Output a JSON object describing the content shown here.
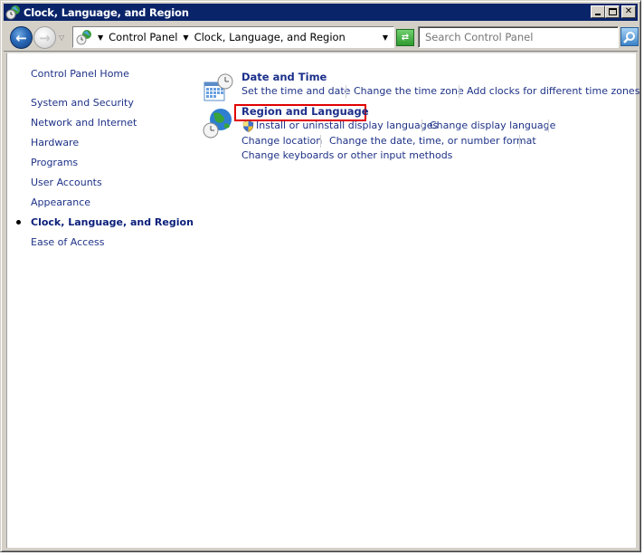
{
  "window": {
    "title": "Clock, Language, and Region",
    "controls": {
      "minimize": "_",
      "maximize": "□",
      "close": "✕"
    }
  },
  "toolbar": {
    "back_icon": "back-arrow-icon",
    "forward_icon": "forward-arrow-icon",
    "breadcrumb": [
      "Control Panel",
      "Clock, Language, and Region"
    ],
    "refresh_icon": "refresh-icon",
    "search_placeholder": "Search Control Panel",
    "search_value": "",
    "search_icon": "magnifier-icon"
  },
  "sidebar": {
    "home": "Control Panel Home",
    "items": [
      {
        "label": "System and Security",
        "active": false
      },
      {
        "label": "Network and Internet",
        "active": false
      },
      {
        "label": "Hardware",
        "active": false
      },
      {
        "label": "Programs",
        "active": false
      },
      {
        "label": "User Accounts",
        "active": false
      },
      {
        "label": "Appearance",
        "active": false
      },
      {
        "label": "Clock, Language, and Region",
        "active": true
      },
      {
        "label": "Ease of Access",
        "active": false
      }
    ]
  },
  "categories": [
    {
      "title": "Date and Time",
      "icon": "calendar-clock-icon",
      "links": [
        "Set the time and date",
        "Change the time zone",
        "Add clocks for different time zones"
      ]
    },
    {
      "title": "Region and Language",
      "icon": "globe-clock-icon",
      "highlighted": true,
      "highlight_color": "#e00000",
      "links": [
        {
          "label": "Install or uninstall display languages",
          "icon": "uac-shield-icon"
        },
        {
          "label": "Change display language"
        },
        {
          "label": "Change location"
        },
        {
          "label": "Change the date, time, or number format"
        },
        {
          "label": "Change keyboards or other input methods"
        }
      ]
    }
  ],
  "colors": {
    "titlebar": "#0a246a",
    "link": "#1e3287",
    "heading": "#1b2f8a",
    "chrome": "#d4d0c8"
  }
}
